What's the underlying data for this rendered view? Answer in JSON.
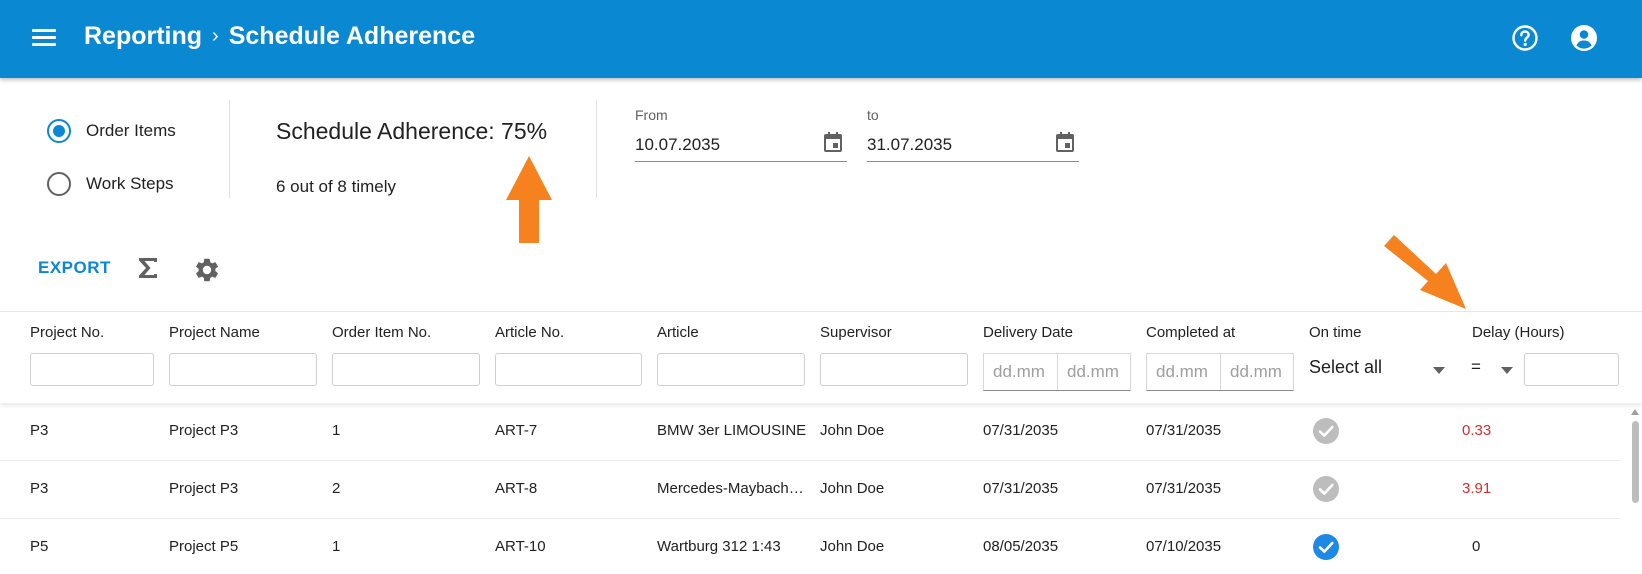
{
  "header": {
    "breadcrumb_parent": "Reporting",
    "breadcrumb_separator": "›",
    "breadcrumb_current": "Schedule Adherence",
    "icons": [
      "menu-icon",
      "help-icon",
      "account-icon"
    ],
    "color": "#0A88D1"
  },
  "mode": {
    "options": [
      {
        "label": "Order Items",
        "checked": true
      },
      {
        "label": "Work Steps",
        "checked": false
      }
    ]
  },
  "summary": {
    "title": "Schedule Adherence: 75%",
    "subtitle": "6 out of 8 timely"
  },
  "date_range": {
    "from_label": "From",
    "from_value": "10.07.2035",
    "to_label": "to",
    "to_value": "31.07.2035"
  },
  "toolbar": {
    "export_label": "EXPORT",
    "icons": [
      "sigma-icon",
      "gear-icon"
    ]
  },
  "table": {
    "columns": [
      "Project No.",
      "Project Name",
      "Order Item No.",
      "Article No.",
      "Article",
      "Supervisor",
      "Delivery Date",
      "Completed at",
      "On time",
      "Delay (Hours)"
    ],
    "filters": {
      "date_placeholder": "dd.mm",
      "on_time_value": "Select all",
      "delay_operator": "="
    },
    "rows": [
      {
        "project_no": "P3",
        "project_name": "Project P3",
        "order_item_no": "1",
        "article_no": "ART-7",
        "article": "BMW 3er LIMOUSINE",
        "supervisor": "John Doe",
        "delivery_date": "07/31/2035",
        "completed_at": "07/31/2035",
        "on_time": false,
        "delay": "0.33"
      },
      {
        "project_no": "P3",
        "project_name": "Project P3",
        "order_item_no": "2",
        "article_no": "ART-8",
        "article": "Mercedes-Maybach S-Class",
        "supervisor": "John Doe",
        "delivery_date": "07/31/2035",
        "completed_at": "07/31/2035",
        "on_time": false,
        "delay": "3.91"
      },
      {
        "project_no": "P5",
        "project_name": "Project P5",
        "order_item_no": "1",
        "article_no": "ART-10",
        "article": "Wartburg 312 1:43",
        "supervisor": "John Doe",
        "delivery_date": "08/05/2035",
        "completed_at": "07/10/2035",
        "on_time": true,
        "delay": "0"
      }
    ]
  },
  "colors": {
    "accent": "#0A88D1",
    "delay_late": "#D32F2F",
    "check_on_time": "#1E88E5",
    "check_late": "#BDBDBD",
    "annotation_arrow": "#F5821F"
  }
}
